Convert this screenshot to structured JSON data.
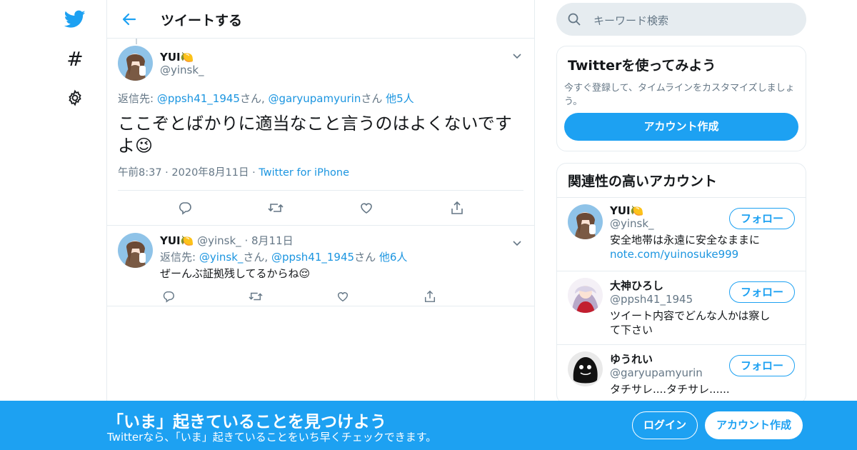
{
  "colors": {
    "accent": "#1da1f2",
    "link": "#1b95e0",
    "muted": "#657786",
    "border": "#e6ecf0"
  },
  "nav": {
    "icons": [
      "twitter-logo-icon",
      "hashtag-icon",
      "gear-icon"
    ],
    "hashtag_glyph": "#"
  },
  "header": {
    "title": "ツイートする"
  },
  "focus_tweet": {
    "name": "YUI🍋",
    "handle": "@yinsk_",
    "reply_label": "返信先: ",
    "reply_to_1": "@ppsh41_1945",
    "sep_1": "さん, ",
    "reply_to_2": "@garyupamyurin",
    "sep_2": "さん ",
    "reply_more": "他5人",
    "text": "ここぞとばかりに適当なこと言うのはよくないですよ😉",
    "time": "午前8:37",
    "date": "2020年8月11日",
    "source": "Twitter for iPhone"
  },
  "reply_tweet": {
    "name": "YUI🍋",
    "handle": "@yinsk_",
    "date": "8月11日",
    "reply_label": "返信先: ",
    "reply_to_1": "@yinsk_",
    "sep_1": "さん, ",
    "reply_to_2": "@ppsh41_1945",
    "sep_2": "さん ",
    "reply_more": "他6人",
    "text": "ぜーんぶ証拠残してるからね😌"
  },
  "search": {
    "placeholder": "キーワード検索"
  },
  "signup_card": {
    "title": "Twitterを使ってみよう",
    "desc": "今すぐ登録して、タイムラインをカスタマイズしましょう。",
    "button": "アカウント作成"
  },
  "related": {
    "title": "関連性の高いアカウント",
    "follow_label": "フォロー",
    "accounts": [
      {
        "name": "YUI🍋",
        "handle": "@yinsk_",
        "bio": "安全地帯は永遠に安全なままに",
        "bio_link": "note.com/yuinosuke999"
      },
      {
        "name": "大神ひろし",
        "handle": "@ppsh41_1945",
        "bio": "ツイート内容でどんな人かは察して下さい",
        "bio_link": ""
      },
      {
        "name": "ゆうれい",
        "handle": "@garyupamyurin",
        "bio": "タチサレ....タチサレ......",
        "bio_link": ""
      }
    ]
  },
  "banner": {
    "title": "「いま」起きていることを見つけよう",
    "subtitle": "Twitterなら、「いま」起きていることをいち早くチェックできます。",
    "login": "ログイン",
    "signup": "アカウント作成"
  }
}
